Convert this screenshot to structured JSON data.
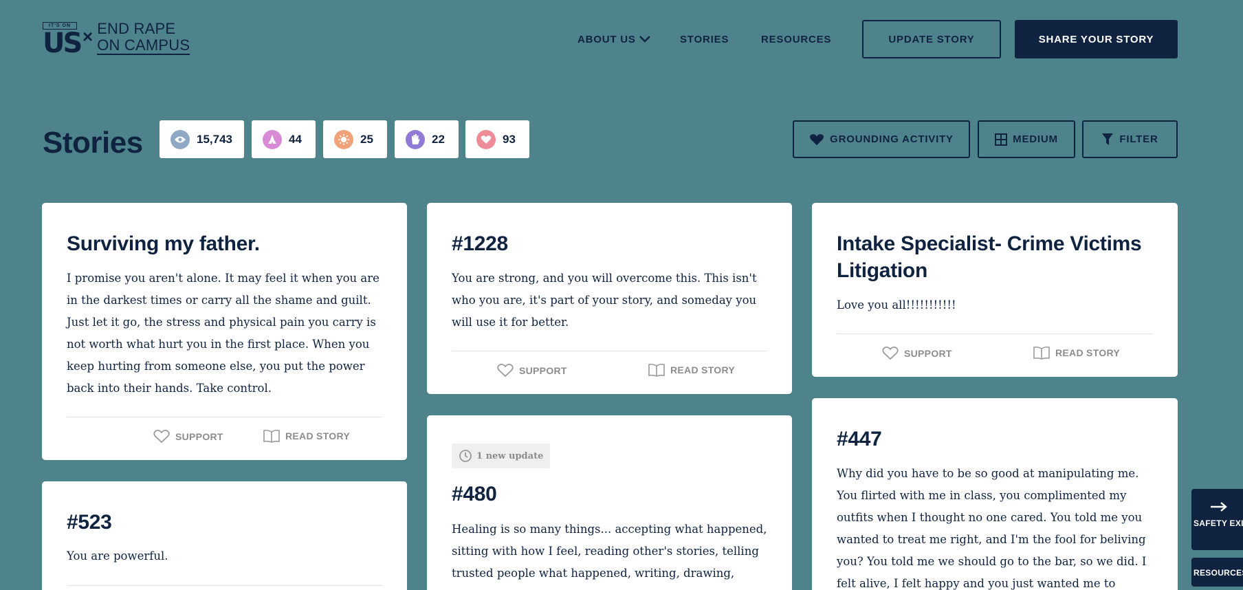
{
  "logo": {
    "badge_text": "IT'S ON",
    "us_text": "US",
    "times": "×",
    "line1": "END RAPE",
    "line2": "ON CAMPUS"
  },
  "nav": {
    "about": "ABOUT US",
    "stories": "STORIES",
    "resources": "RESOURCES",
    "update_story": "UPDATE STORY",
    "share_story": "SHARE YOUR STORY"
  },
  "page": {
    "title": "Stories"
  },
  "stats": [
    {
      "icon": "eye-icon",
      "value": "15,743",
      "color": "#8fa9c4"
    },
    {
      "icon": "praying-hands-icon",
      "value": "44",
      "color": "#d98ad6"
    },
    {
      "icon": "sun-icon",
      "value": "25",
      "color": "#f1a27a"
    },
    {
      "icon": "raised-hand-icon",
      "value": "22",
      "color": "#8f7ad6"
    },
    {
      "icon": "heart-icon",
      "value": "93",
      "color": "#ee8c97"
    }
  ],
  "tools": {
    "grounding": "GROUNDING ACTIVITY",
    "medium": "MEDIUM",
    "filter": "FILTER"
  },
  "cards": [
    {
      "title": "Surviving my father.",
      "body": "I promise you aren't alone. It may feel it when you are in the darkest times or carry all the shame and guilt. Just let it go, the stress and physical pain you carry is not worth what hurt you in the first place. When you keep hurting from someone else, you put the power back into their hands. Take control.",
      "support": "SUPPORT",
      "read": "READ STORY"
    },
    {
      "title": "#1228",
      "body": "You are strong, and you will overcome this. This isn't who you are, it's part of your story, and someday you will use it for better.",
      "support": "SUPPORT",
      "read": "READ STORY"
    },
    {
      "title": "Intake Specialist- Crime Victims Litigation",
      "body": "Love you all!!!!!!!!!!!",
      "support": "SUPPORT",
      "read": "READ STORY"
    },
    {
      "title": "#523",
      "body": "You are powerful."
    },
    {
      "badge": "1 new update",
      "title": "#480",
      "body": "Healing is so many things... accepting what happened, sitting with how I feel, reading other's stories, telling trusted people what happened, writing, drawing,"
    },
    {
      "title": "#447",
      "body": "Why did you have to be so good at manipulating me. You flirted with me in class, you complimented my outfits when I thought no one cared. You told me you wanted to treat me right, and I'm the fool for beliving you? You told me we should go to the bar, so we did. I felt alive, I felt happy and you just wanted me to"
    }
  ],
  "side": {
    "safety_exit": "SAFETY EXIT",
    "resources": "RESOURCES"
  },
  "colors": {
    "background": "#4f838c",
    "navy": "#0f2341",
    "card": "#ffffff",
    "muted": "#8c8c8c"
  }
}
